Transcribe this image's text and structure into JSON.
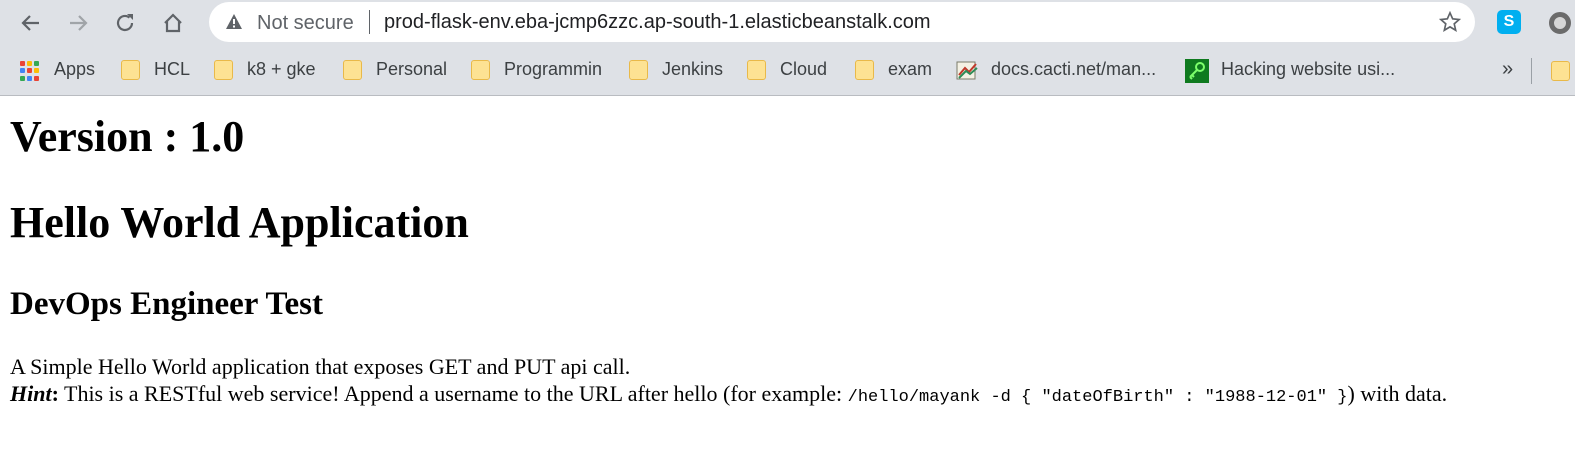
{
  "browser": {
    "security_label": "Not secure",
    "url": "prod-flask-env.eba-jcmp6zzc.ap-south-1.elasticbeanstalk.com",
    "extensions": [
      "skype-icon",
      "extension-icon"
    ]
  },
  "bookmarks": [
    {
      "label": "Apps",
      "icon": "apps-icon"
    },
    {
      "label": "HCL",
      "icon": "folder-icon"
    },
    {
      "label": "k8 + gke",
      "icon": "folder-icon"
    },
    {
      "label": "Personal",
      "icon": "folder-icon"
    },
    {
      "label": "Programmin",
      "icon": "folder-icon"
    },
    {
      "label": "Jenkins",
      "icon": "folder-icon"
    },
    {
      "label": "Cloud",
      "icon": "folder-icon"
    },
    {
      "label": "exam",
      "icon": "folder-icon"
    },
    {
      "label": "docs.cacti.net/man...",
      "icon": "cacti-icon"
    },
    {
      "label": "Hacking website usi...",
      "icon": "key-icon"
    }
  ],
  "bookmarks_more": "»",
  "page": {
    "version_heading": "Version : 1.0",
    "app_heading": "Hello World Application",
    "sub_heading": "DevOps Engineer Test",
    "description": "A Simple Hello World application that exposes GET and PUT api call.",
    "hint_label": "Hint",
    "hint_colon": ":",
    "hint_text_before": " This is a RESTful web service! Append a username to the URL after hello (for example: ",
    "hint_code": "/hello/mayank -d { \"dateOfBirth\" : \"1988-12-01\" }",
    "hint_text_after": ") with data."
  },
  "colors": {
    "chrome_bg": "#dee1e6",
    "folder": "#fde293",
    "skype": "#00aff0"
  }
}
